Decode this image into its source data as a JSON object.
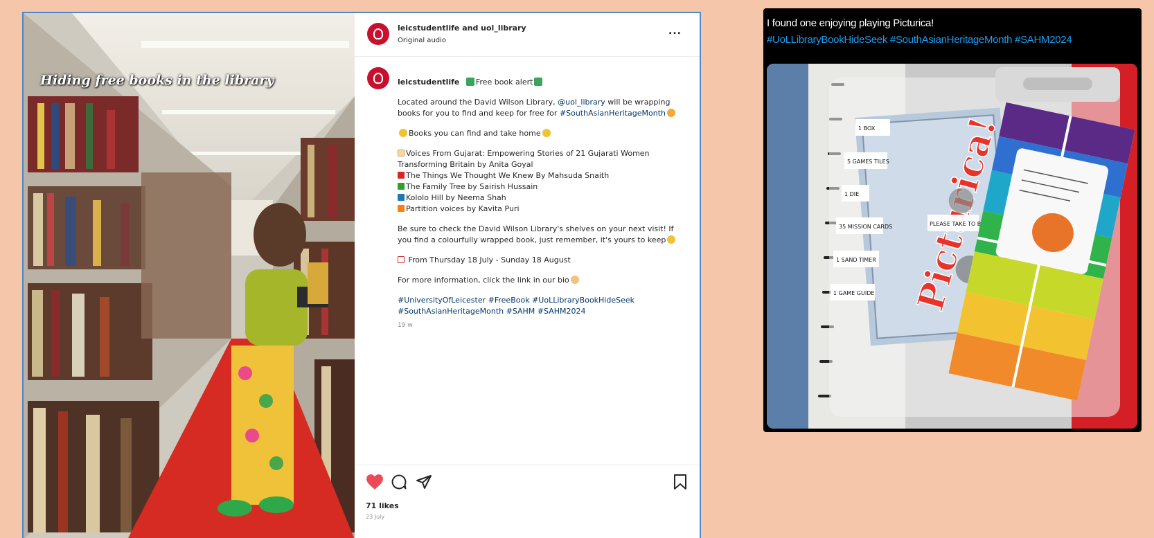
{
  "instagram": {
    "overlay_text": "Hiding free books in the library",
    "header": {
      "username": "leicstudentlife and uol_library",
      "audio": "Original audio",
      "more": "..."
    },
    "caption": {
      "username": "leicstudentlife",
      "headline": "Free book alert",
      "intro_pre": "Located around the David Wilson Library, ",
      "intro_mention": "@uol_library",
      "intro_post": " will be wrapping books for you to find and keep for free for ",
      "intro_tag": "#SouthAsianHeritageMonth",
      "books_heading": "Books you can find and take home",
      "books": [
        {
          "title": "Voices From Gujarat: Empowering Stories of 21 Gujarati Women Transforming Britain by Anita Goyal",
          "color": "#f4d9a0"
        },
        {
          "title": "The Things We Thought We Knew By Mahsuda Snaith",
          "color": "#d62728"
        },
        {
          "title": "The Family Tree by Sairish Hussain",
          "color": "#2ca02c"
        },
        {
          "title": "Kololo Hill by Neema Shah",
          "color": "#1f77b4"
        },
        {
          "title": "Partition voices by Kavita Puri",
          "color": "#ff7f0e"
        }
      ],
      "reminder": "Be sure to check the David Wilson Library's shelves on your next visit! If you find a colourfully wrapped book, just remember, it's yours to keep",
      "dates": "From Thursday 18 July - Sunday 18 August",
      "more_info": "For more information, click the link in our bio",
      "hashtags_line1": "#UniversityOfLeicester #FreeBook #UoLLibraryBookHideSeek",
      "hashtags_line2": "#SouthAsianHeritageMonth #SAHM #SAHM2024",
      "time_ago": "19 w"
    },
    "likes": "71 likes",
    "date": "23 July",
    "icons": [
      "heart-icon",
      "comment-icon",
      "share-icon",
      "bookmark-icon"
    ],
    "colors": {
      "heart": "#ed4956",
      "accent": "#c8102e",
      "link": "#00376b"
    }
  },
  "tweet": {
    "text": "I found one enjoying playing Picturica!",
    "hashtags": "#UoLLibraryBookHideSeek #SouthAsianHeritageMonth #SAHM2024",
    "photo": {
      "game_title": "Picturica!",
      "contents_labels": [
        "1 BOX",
        "5 GAMES TILES",
        "1 DIE",
        "35 MISSION CARDS",
        "1 SAND TIMER",
        "1 GAME GUIDE"
      ],
      "note": "PLEASE TAKE TO BE"
    },
    "colors": {
      "hashtag": "#1d9bf0"
    }
  }
}
